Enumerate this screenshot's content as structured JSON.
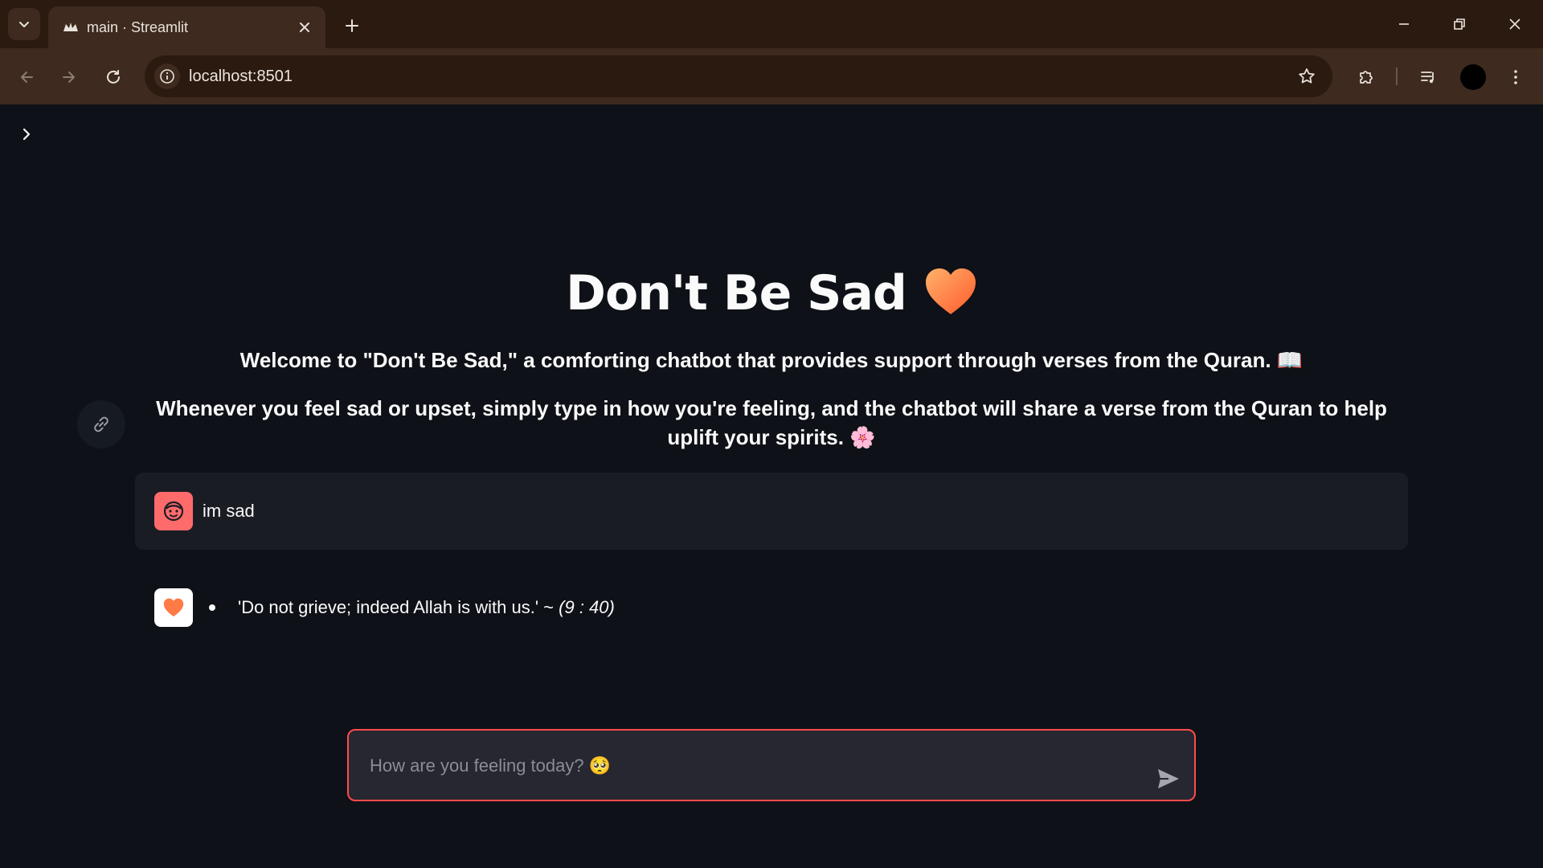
{
  "browser": {
    "tab_title": "main · Streamlit",
    "url": "localhost:8501"
  },
  "icons": {
    "tab_list": "chevron-down-icon",
    "favicon": "streamlit-crown-icon",
    "tab_close": "close-icon",
    "new_tab": "plus-icon",
    "minimize": "minimize-icon",
    "restore": "restore-icon",
    "close_window": "close-icon",
    "back": "arrow-left-icon",
    "forward": "arrow-right-icon",
    "reload": "reload-icon",
    "site_info": "info-icon",
    "bookmark": "star-icon",
    "extensions": "puzzle-icon",
    "media": "playlist-icon",
    "menu": "kebab-icon",
    "sidebar_toggle": "chevron-right-icon",
    "anchor": "link-icon",
    "user_avatar": "face-icon",
    "bot_avatar": "heart-icon",
    "send": "send-icon"
  },
  "app": {
    "title": "Don't Be Sad",
    "title_emoji": "🧡",
    "intro_line_1": "Welcome to \"Don't Be Sad,\" a comforting chatbot that provides support through verses from the Quran. 📖",
    "intro_line_2": "Whenever you feel sad or upset, simply type in how you're feeling, and the chatbot will share a verse from the Quran to help uplift your spirits. 🌸"
  },
  "chat": {
    "messages": [
      {
        "role": "user",
        "text": "im sad"
      },
      {
        "role": "assistant",
        "text": "'Do not grieve; indeed Allah is with us.' ~ ",
        "reference": "(9 : 40)"
      }
    ],
    "input_placeholder": "How are you feeling today? 🥺",
    "input_value": ""
  },
  "colors": {
    "page_bg": "#0e1117",
    "accent": "#ff4b4b",
    "user_avatar_bg": "#ff6b6b",
    "heart": "#ff7a45",
    "browser_frame": "#3e2a1e"
  }
}
